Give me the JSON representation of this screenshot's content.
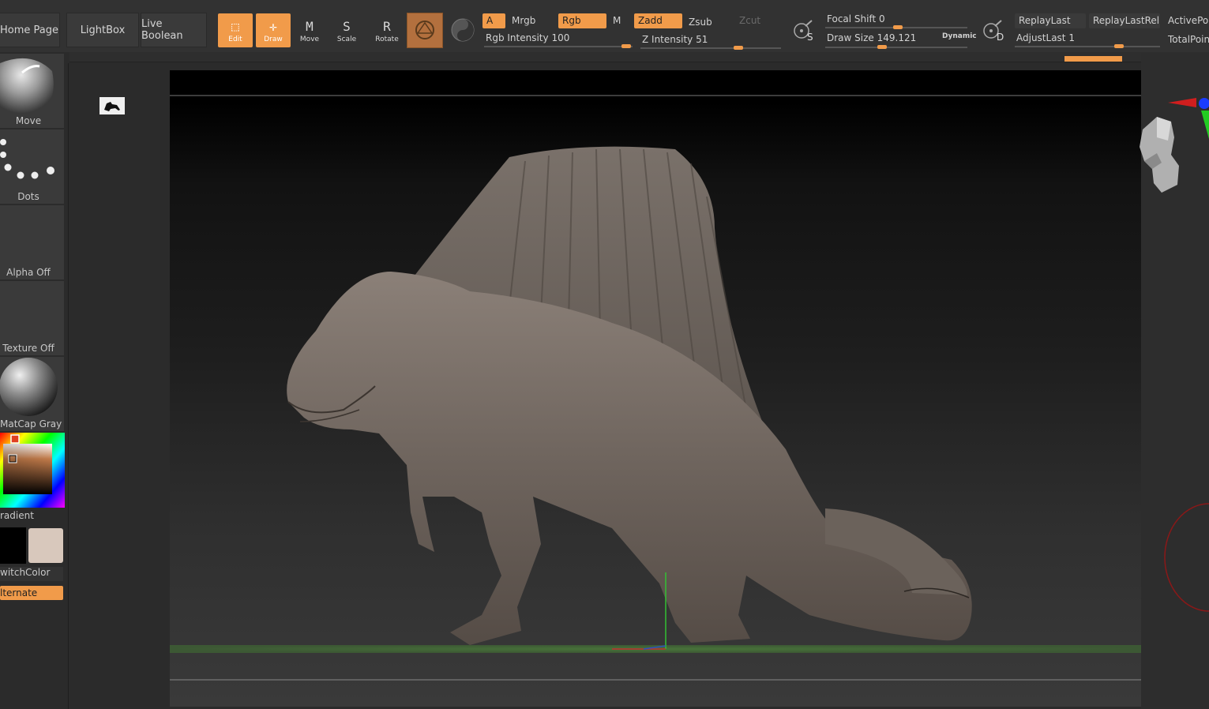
{
  "topbar": {
    "home_label": "Home Page",
    "lightbox_label": "LightBox",
    "live_boolean_label": "Live Boolean",
    "tools": [
      {
        "label": "Edit",
        "glyph": "⬚",
        "active": true
      },
      {
        "label": "Draw",
        "glyph": "✛",
        "active": true
      },
      {
        "label": "Move",
        "glyph": "M",
        "active": false
      },
      {
        "label": "Scale",
        "glyph": "S",
        "active": false
      },
      {
        "label": "Rotate",
        "glyph": "R",
        "active": false
      }
    ],
    "channels": {
      "a": "A",
      "mrgb": "Mrgb",
      "rgb": "Rgb",
      "m": "M",
      "zadd": "Zadd",
      "zsub": "Zsub",
      "zcut": "Zcut"
    },
    "rgb_intensity": {
      "label": "Rgb Intensity",
      "value": "100",
      "fraction": 1.0
    },
    "z_intensity": {
      "label": "Z Intensity",
      "value": "51",
      "fraction": 0.51
    },
    "focal_shift": {
      "label": "Focal Shift",
      "value": "0",
      "fraction": 0.5
    },
    "draw_size": {
      "label": "Draw Size",
      "value": "149.121",
      "fraction": 0.4
    },
    "dynamic_label": "Dynamic",
    "s_label": "S",
    "d_label": "D",
    "replay_last": "ReplayLast",
    "replay_last_rel": "ReplayLastRel",
    "adjust_last": {
      "label": "AdjustLast",
      "value": "1",
      "fraction": 0.5
    },
    "active_points": "ActivePoi",
    "total_points": "TotalPoin"
  },
  "sidebar": {
    "brush_label": "Move",
    "stroke_label": "Dots",
    "alpha_label": "Alpha Off",
    "texture_label": "Texture Off",
    "material_label": "MatCap Gray",
    "gradient_label": "radient",
    "switch_color_label": "witchColor",
    "alternate_label": "lternate"
  },
  "colors": {
    "accent": "#f19b4a",
    "main_color": "#000000",
    "secondary_color": "#d8c8bc"
  }
}
